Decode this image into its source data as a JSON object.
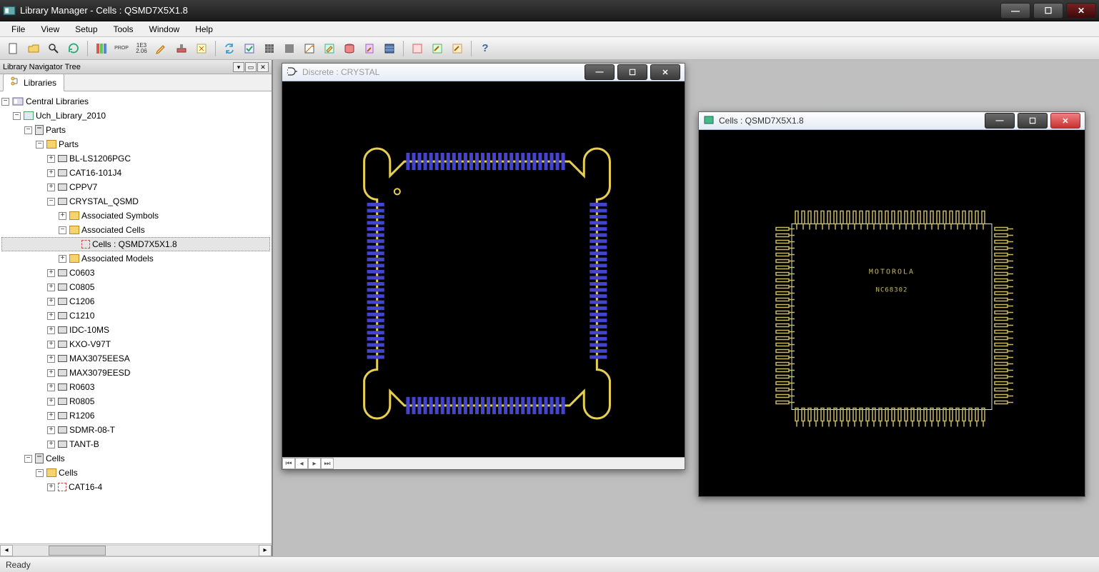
{
  "window": {
    "title": "Library Manager - Cells : QSMD7X5X1.8"
  },
  "menu": [
    "File",
    "View",
    "Setup",
    "Tools",
    "Window",
    "Help"
  ],
  "toolbar_groups": [
    [
      "new-file",
      "open-file",
      "search",
      "refresh"
    ],
    [
      "tree-columns",
      "props",
      "units",
      "edit",
      "stamp",
      "wizard"
    ],
    [
      "sync",
      "check",
      "grid",
      "fill",
      "note",
      "edit2",
      "db",
      "pin",
      "layers"
    ],
    [
      "gen1",
      "gen2",
      "gen3"
    ],
    [
      "help"
    ]
  ],
  "toolbar_labels": {
    "props": "PROP",
    "units_top": "1E3",
    "units_bot": "2.06"
  },
  "sidebar": {
    "panel_title": "Library Navigator Tree",
    "tab": "Libraries",
    "tree": {
      "root": "Central Libraries",
      "lib": "Uch_Library_2010",
      "parts_section": "Parts",
      "parts_folder": "Parts",
      "parts": [
        "BL-LS1206PGC",
        "CAT16-101J4",
        "CPPV7",
        "CRYSTAL_QSMD",
        "C0603",
        "C0805",
        "C1206",
        "C1210",
        "IDC-10MS",
        "KXO-V97T",
        "MAX3075EESA",
        "MAX3079EESD",
        "R0603",
        "R0805",
        "R1206",
        "SDMR-08-T",
        "TANT-B"
      ],
      "assoc_symbols": "Associated Symbols",
      "assoc_cells": "Associated Cells",
      "assoc_cell_item": "Cells : QSMD7X5X1.8",
      "assoc_models": "Associated Models",
      "cells_section": "Cells",
      "cells_folder": "Cells",
      "cells": [
        "CAT16-4"
      ]
    }
  },
  "windows": {
    "discrete": {
      "title": "Discrete : CRYSTAL"
    },
    "cells": {
      "title": "Cells : QSMD7X5X1.8",
      "chip_text1": "MOTOROLA",
      "chip_text2": "NC68302"
    }
  },
  "status": "Ready"
}
